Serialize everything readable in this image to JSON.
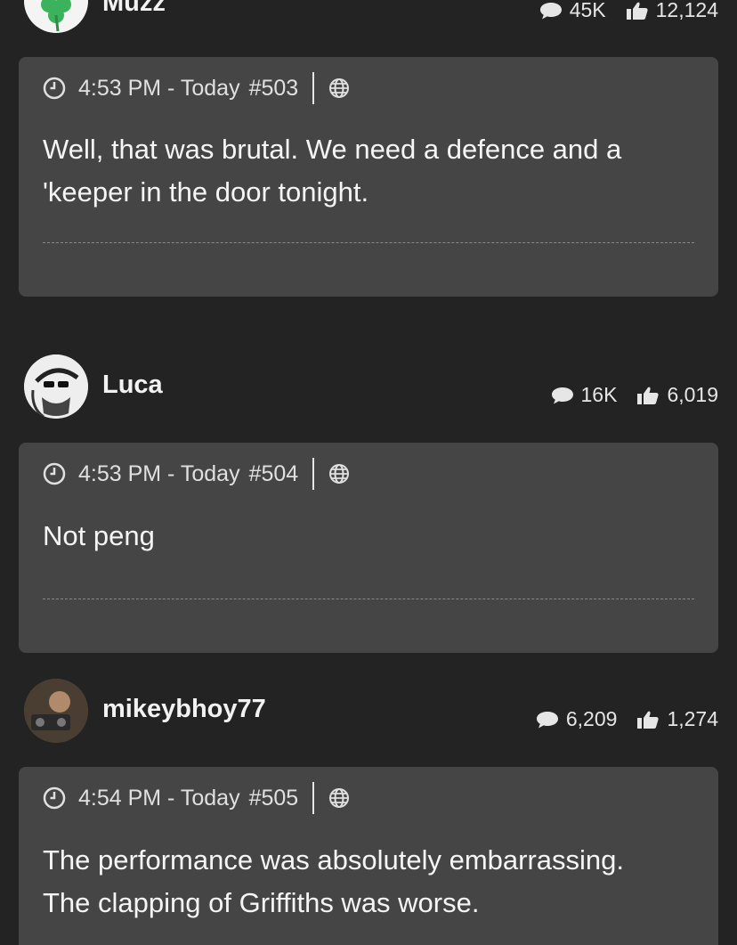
{
  "users": [
    {
      "name": "Muzz",
      "comments": "45K",
      "likes": "12,124",
      "avatar": "shamrock-avatar"
    },
    {
      "name": "Luca",
      "comments": "16K",
      "likes": "6,019",
      "avatar": "sketch-face-avatar"
    },
    {
      "name": "mikeybhoy77",
      "comments": "6,209",
      "likes": "1,274",
      "avatar": "photo-avatar"
    }
  ],
  "posts": [
    {
      "time": "4:53 PM - Today",
      "number": "#503",
      "body": "Well, that was brutal. We need a defence and a 'keeper in the door tonight."
    },
    {
      "time": "4:53 PM - Today",
      "number": "#504",
      "body": "Not peng"
    },
    {
      "time": "4:54 PM - Today",
      "number": "#505",
      "body": "The performance was absolutely embarrassing. The clapping of Griffiths was worse."
    }
  ],
  "icons": {
    "comment": "speech-bubble-icon",
    "like": "thumbs-up-icon",
    "time": "clock-icon",
    "visibility": "globe-icon"
  },
  "colors": {
    "background": "#232323",
    "card": "#454545",
    "text": "#ececec"
  }
}
